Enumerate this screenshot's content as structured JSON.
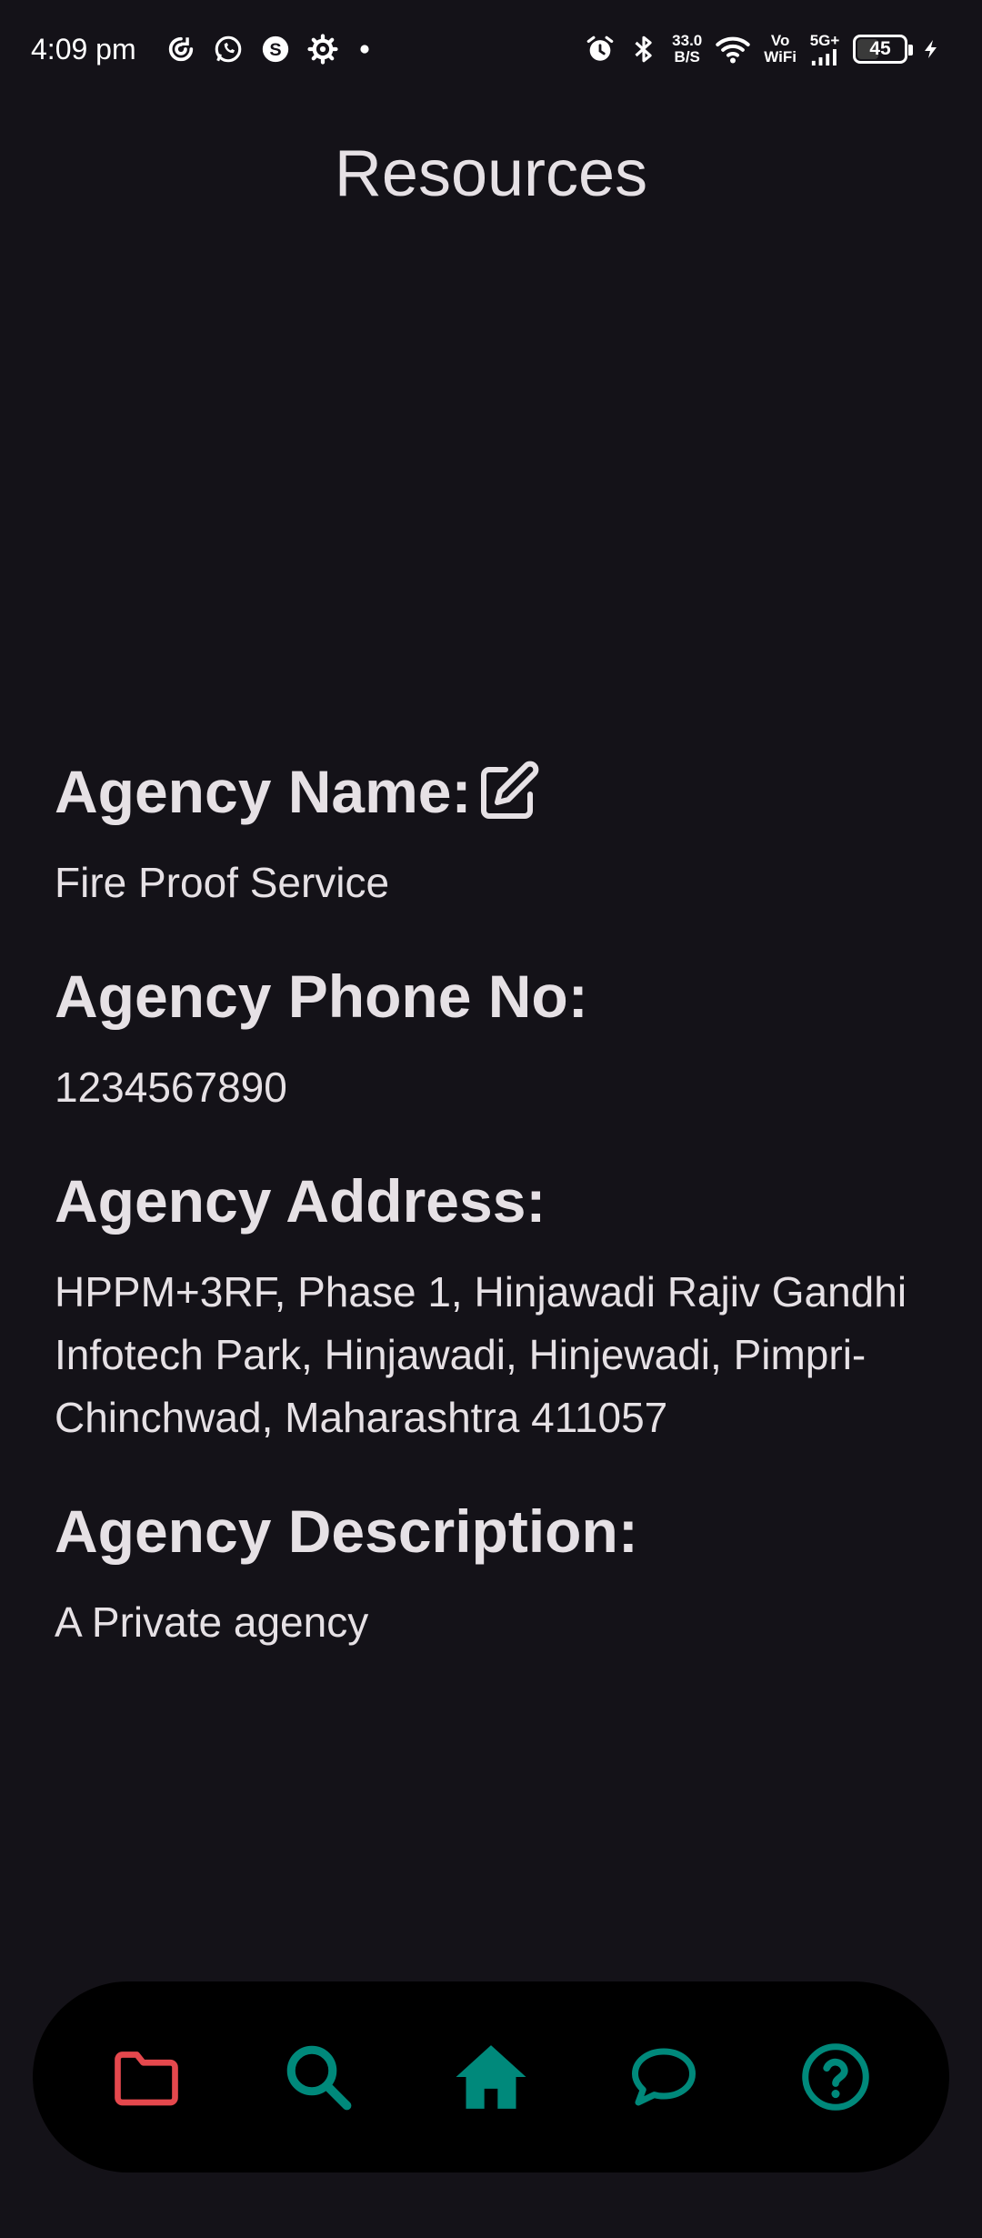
{
  "status_bar": {
    "time": "4:09 pm",
    "speed_value": "33.0",
    "speed_unit": "B/S",
    "vo": "Vo",
    "wifi": "WiFi",
    "network": "5G+",
    "battery": "45",
    "battery_level": 0.45,
    "icons": [
      "sync-icon",
      "whatsapp-icon",
      "app-s-icon",
      "settings-icon",
      "dot-icon",
      "alarm-icon",
      "bluetooth-icon",
      "wifi-icon",
      "signal-icon",
      "charging-icon"
    ]
  },
  "page": {
    "title": "Resources"
  },
  "agency": {
    "name_label": "Agency Name:",
    "name": "Fire Proof Service",
    "phone_label": "Agency Phone No:",
    "phone": "1234567890",
    "address_label": "Agency Address:",
    "address": "HPPM+3RF, Phase 1, Hinjawadi Rajiv Gandhi Infotech Park, Hinjawadi, Hinjewadi, Pimpri-Chinchwad, Maharashtra 411057",
    "description_label": "Agency Description:",
    "description": "A Private agency"
  },
  "bottom_nav": {
    "items": [
      {
        "icon": "folder-icon",
        "color": "#e5484d"
      },
      {
        "icon": "search-icon",
        "color": "#00897b"
      },
      {
        "icon": "home-icon",
        "color": "#00897b"
      },
      {
        "icon": "chat-icon",
        "color": "#00897b"
      },
      {
        "icon": "help-icon",
        "color": "#00897b"
      }
    ]
  },
  "colors": {
    "background": "#141218",
    "text": "#e6e1e5",
    "nav_background": "#000000",
    "accent_red": "#e5484d",
    "accent_teal": "#00897b"
  }
}
